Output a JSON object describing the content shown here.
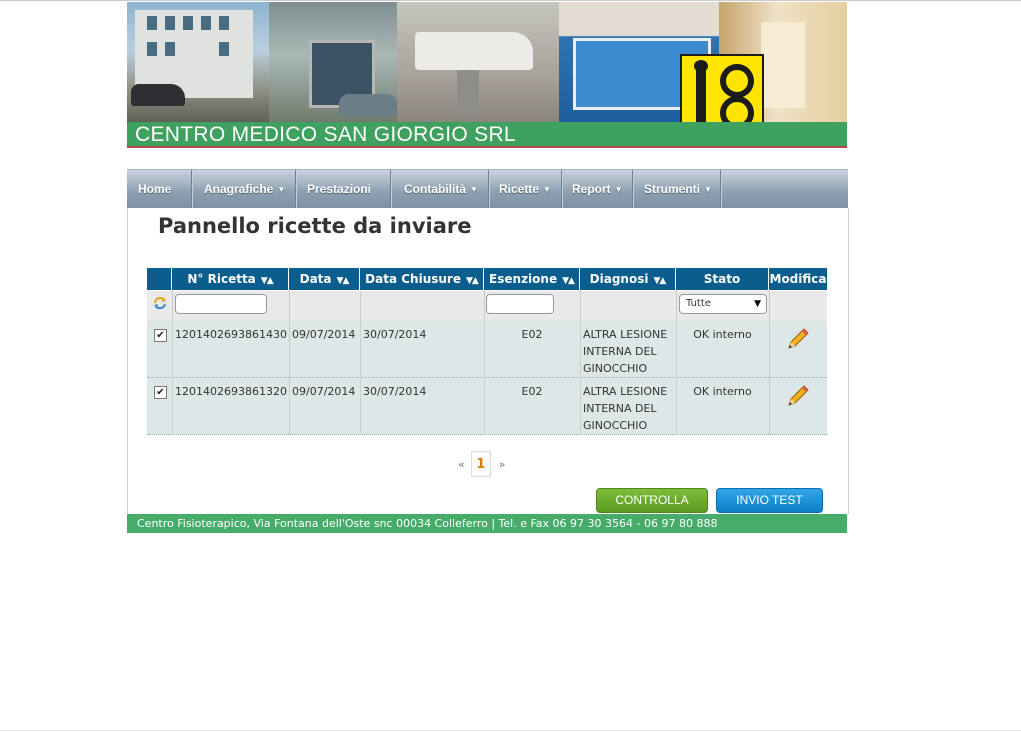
{
  "banner": {
    "title": "CENTRO MEDICO SAN GIORGIO SRL"
  },
  "nav": {
    "items": [
      {
        "label": "Home",
        "has_menu": false
      },
      {
        "label": "Anagrafiche",
        "has_menu": true
      },
      {
        "label": "Prestazioni",
        "has_menu": false
      },
      {
        "label": "Contabilità",
        "has_menu": true
      },
      {
        "label": "Ricette",
        "has_menu": true
      },
      {
        "label": "Report",
        "has_menu": true
      },
      {
        "label": "Strumenti",
        "has_menu": true
      }
    ]
  },
  "page": {
    "title": "Pannello ricette da inviare"
  },
  "table": {
    "columns": [
      {
        "label": "N° Ricetta",
        "sortable": true
      },
      {
        "label": "Data",
        "sortable": true
      },
      {
        "label": "Data Chiusure",
        "sortable": true
      },
      {
        "label": "Esenzione",
        "sortable": true
      },
      {
        "label": "Diagnosi",
        "sortable": true
      },
      {
        "label": "Stato",
        "sortable": false
      },
      {
        "label": "Modifica",
        "sortable": false
      }
    ],
    "filters": {
      "numero_value": "",
      "esenzione_value": "",
      "stato_selected": "Tutte"
    },
    "rows": [
      {
        "checked": true,
        "numero": "1201402693861430",
        "data": "09/07/2014",
        "data_chiusure": "30/07/2014",
        "esenzione": "E02",
        "diagnosi": [
          "ALTRA LESIONE",
          "INTERNA DEL",
          "GINOCCHIO"
        ],
        "stato": "OK interno"
      },
      {
        "checked": true,
        "numero": "1201402693861320",
        "data": "09/07/2014",
        "data_chiusure": "30/07/2014",
        "esenzione": "E02",
        "diagnosi": [
          "ALTRA LESIONE",
          "INTERNA DEL",
          "GINOCCHIO"
        ],
        "stato": "OK interno"
      }
    ]
  },
  "pager": {
    "prev": "«",
    "current": "1",
    "next": "»"
  },
  "actions": {
    "controlla_label": "CONTROLLA",
    "invio_test_label": "INVIO TEST"
  },
  "footer": {
    "text": "Centro Fisioterapico, Via Fontana dell'Oste snc 00034 Colleferro | Tel. e Fax 06 97 30 3564 - 06 97 80 888"
  },
  "icons": {
    "refresh": "refresh-icon",
    "edit": "pencil-icon",
    "sort": "sort-arrows-icon",
    "dropdown": "caret-down-icon"
  },
  "colors": {
    "header_blue": "#0a5d8c",
    "brand_green": "#3fa15f",
    "row_bg": "#dde7e8",
    "button_green": "#5a9a1f",
    "button_blue": "#0a7fc7",
    "pager_current": "#d97b00"
  }
}
